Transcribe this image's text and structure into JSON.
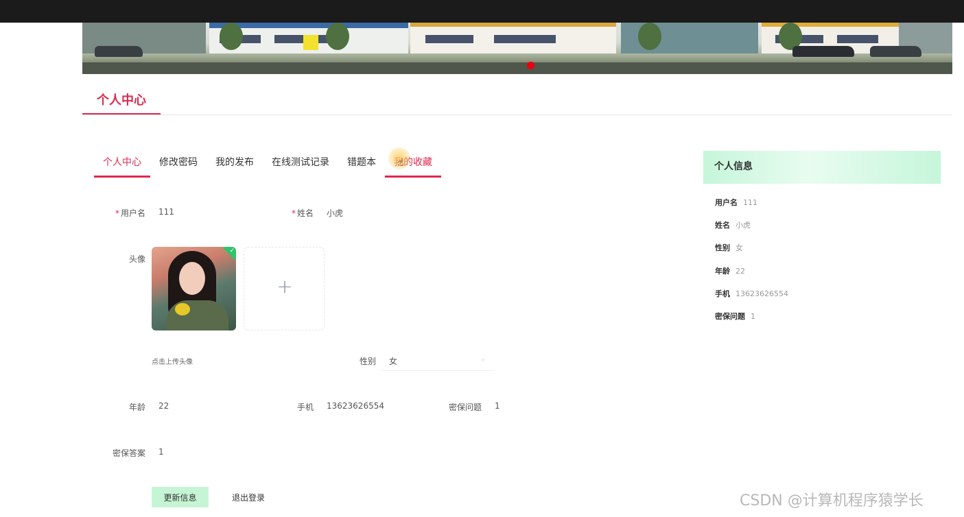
{
  "header": {
    "section_title": "个人中心"
  },
  "tabs": [
    {
      "label": "个人中心"
    },
    {
      "label": "修改密码"
    },
    {
      "label": "我的发布"
    },
    {
      "label": "在线测试记录"
    },
    {
      "label": "错题本"
    },
    {
      "label": "我的收藏"
    }
  ],
  "form": {
    "username_label": "用户名",
    "username_value": "111",
    "name_label": "姓名",
    "name_value": "小虎",
    "avatar_label": "头像",
    "upload_tip": "点击上传头像",
    "upload_plus": "+",
    "gender_label": "性别",
    "gender_value": "女",
    "age_label": "年龄",
    "age_value": "22",
    "phone_label": "手机",
    "phone_value": "13623626554",
    "question_label": "密保问题",
    "question_value": "1",
    "answer_label": "密保答案",
    "answer_value": "1",
    "update_button": "更新信息",
    "logout_button": "退出登录"
  },
  "sidebar": {
    "title": "个人信息",
    "rows": [
      {
        "key": "用户名",
        "value": "111"
      },
      {
        "key": "姓名",
        "value": "小虎"
      },
      {
        "key": "性别",
        "value": "女"
      },
      {
        "key": "年龄",
        "value": "22"
      },
      {
        "key": "手机",
        "value": "13623626554"
      },
      {
        "key": "密保问题",
        "value": "1"
      }
    ]
  },
  "watermark": "CSDN @计算机程序猿学长",
  "colors": {
    "accent": "#e0284f",
    "button_green": "#c6f5d5",
    "sidebar_header": "#c6f6da"
  }
}
